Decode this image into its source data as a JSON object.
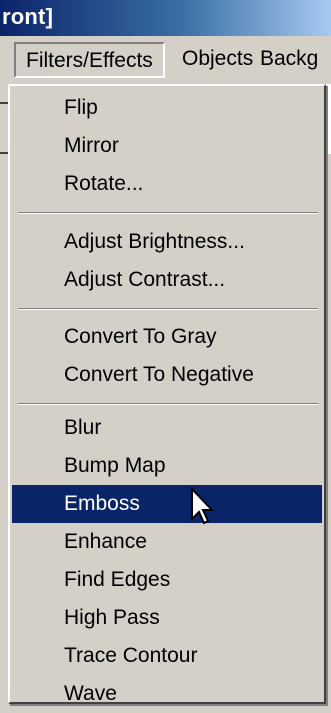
{
  "window": {
    "title_fragment": "ront]"
  },
  "menubar": {
    "items": [
      {
        "label": "Filters/Effects"
      },
      {
        "label": "Objects"
      },
      {
        "label": "Backg"
      }
    ]
  },
  "menu": {
    "open": "Filters/Effects",
    "selected": "Emboss",
    "groups": [
      [
        {
          "label": "Flip"
        },
        {
          "label": "Mirror"
        },
        {
          "label": "Rotate..."
        }
      ],
      [
        {
          "label": "Adjust Brightness..."
        },
        {
          "label": "Adjust Contrast..."
        }
      ],
      [
        {
          "label": "Convert To Gray"
        },
        {
          "label": "Convert To Negative"
        }
      ],
      [
        {
          "label": "Blur"
        },
        {
          "label": "Bump Map"
        },
        {
          "label": "Emboss"
        },
        {
          "label": "Enhance"
        },
        {
          "label": "Find Edges"
        },
        {
          "label": "High Pass"
        },
        {
          "label": "Trace Contour"
        },
        {
          "label": "Wave"
        }
      ]
    ]
  },
  "colors": {
    "highlight": "#0a246a",
    "menu_bg": "#d4d0c8",
    "title_start": "#0a246a",
    "title_end": "#a6caf0"
  }
}
